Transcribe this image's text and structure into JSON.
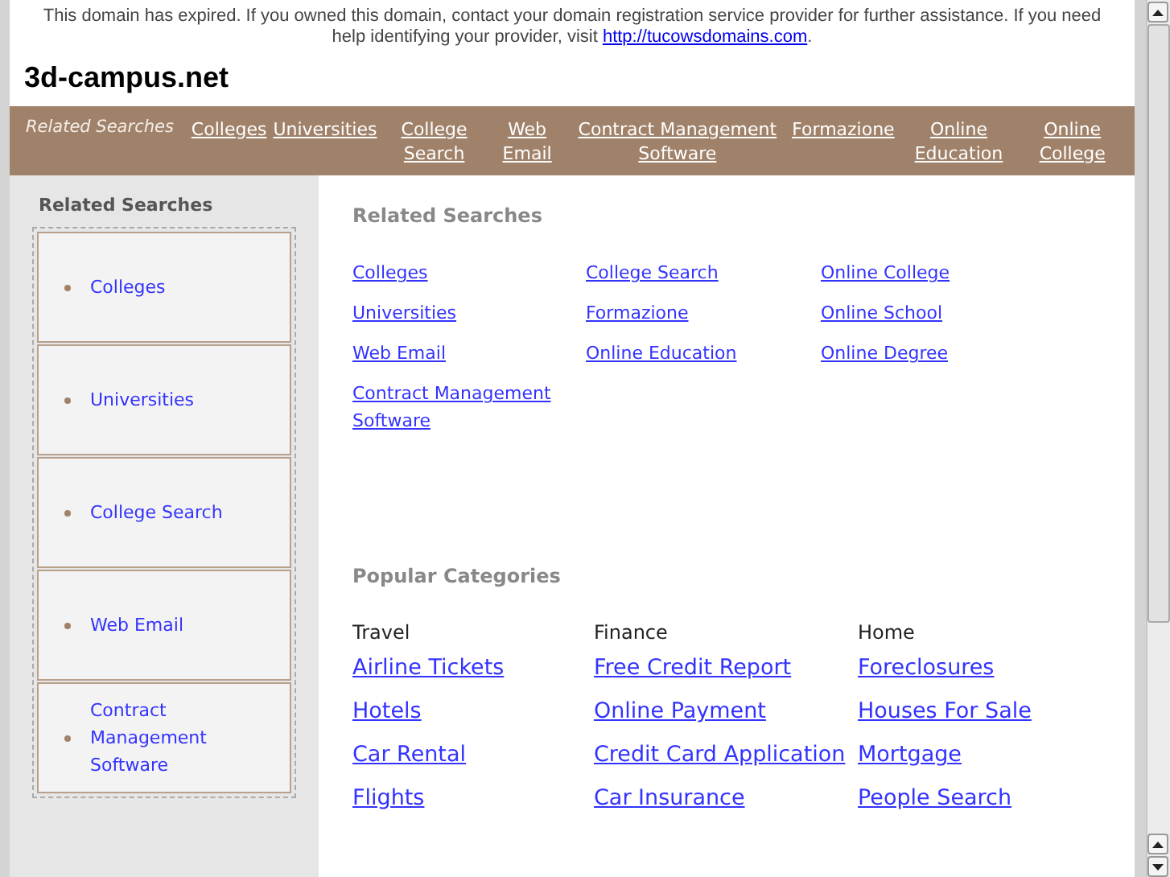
{
  "notice": {
    "text": "This domain has expired. If you owned this domain, contact your domain registration service provider for further assistance. If you need help identifying your provider, visit",
    "link": "http://tucowsdomains.com",
    "end": "."
  },
  "site_title": "3d-campus.net",
  "top_bar": {
    "label": "Related Searches",
    "links": [
      "Colleges",
      "Universities",
      "College Search",
      "Web Email",
      "Contract Management Software",
      "Formazione",
      "Online Education",
      "Online College"
    ]
  },
  "sidebar": {
    "heading": "Related Searches",
    "items": [
      "Colleges",
      "Universities",
      "College Search",
      "Web Email",
      "Contract Management Software"
    ]
  },
  "related": {
    "heading": "Related Searches",
    "columns": [
      [
        "Colleges",
        "Universities",
        "Web Email",
        "Contract Management Software"
      ],
      [
        "College Search",
        "Formazione",
        "Online Education"
      ],
      [
        "Online College",
        "Online School",
        "Online Degree"
      ]
    ]
  },
  "popular": {
    "heading": "Popular Categories",
    "columns": [
      {
        "title": "Travel",
        "links": [
          "Airline Tickets",
          "Hotels",
          "Car Rental",
          "Flights"
        ]
      },
      {
        "title": "Finance",
        "links": [
          "Free Credit Report",
          "Online Payment",
          "Credit Card Application",
          "Car Insurance"
        ]
      },
      {
        "title": "Home",
        "links": [
          "Foreclosures",
          "Houses For Sale",
          "Mortgage",
          "People Search"
        ]
      }
    ]
  }
}
